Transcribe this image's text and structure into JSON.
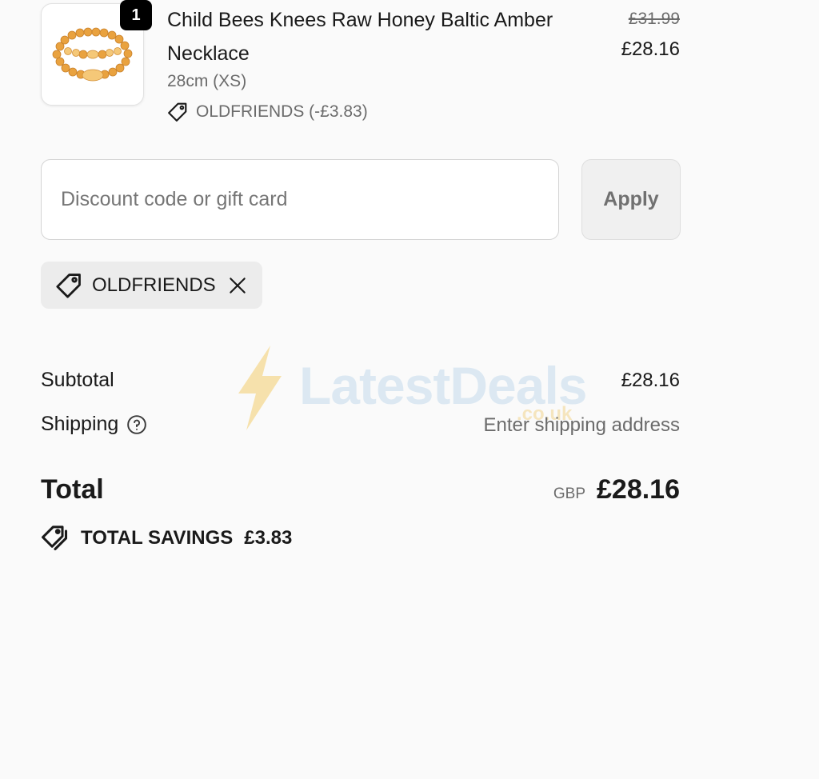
{
  "product": {
    "quantity": "1",
    "title": "Child Bees Knees Raw Honey Baltic Amber Necklace",
    "variant": "28cm (XS)",
    "discount_text": "OLDFRIENDS (-£3.83)",
    "compare_price": "£31.99",
    "price": "£28.16",
    "image_icon": "amber-necklace-image",
    "colors": {
      "amber": "#e9a23f",
      "amber_light": "#f5c878"
    }
  },
  "discount": {
    "placeholder": "Discount code or gift card",
    "value": "",
    "apply_label": "Apply"
  },
  "applied_code": {
    "code": "OLDFRIENDS",
    "tag_icon": "tag-icon",
    "remove_icon": "close-icon"
  },
  "summary": {
    "subtotal_label": "Subtotal",
    "subtotal_value": "£28.16",
    "shipping_label": "Shipping",
    "shipping_help_icon": "question-circle-icon",
    "shipping_value": "Enter shipping address",
    "total_label": "Total",
    "currency": "GBP",
    "total_value": "£28.16",
    "savings_label": "TOTAL SAVINGS",
    "savings_value": "£3.83",
    "savings_icon": "tags-icon"
  },
  "watermark": {
    "brand": "LatestDeals",
    "domain": ".co.uk",
    "logo_icon": "lightning-bolt-icon",
    "colors": {
      "text": "#b8d4ea",
      "bolt": "#f3c54f"
    }
  }
}
